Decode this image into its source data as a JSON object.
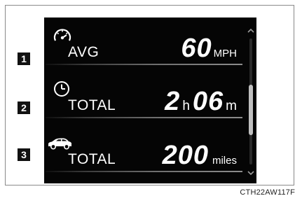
{
  "badges": [
    "1",
    "2",
    "3"
  ],
  "rows": [
    {
      "icon": "speedometer-icon",
      "label": "AVG",
      "value": "60",
      "unit": "MPH"
    },
    {
      "icon": "clock-icon",
      "label": "TOTAL",
      "hours": "2",
      "hours_unit": "h",
      "minutes": "06",
      "minutes_unit": "m"
    },
    {
      "icon": "car-icon",
      "label": "TOTAL",
      "value": "200",
      "unit": "miles"
    }
  ],
  "scroll": {
    "up_icon": "chevron-up-icon",
    "down_icon": "chevron-down-icon",
    "position_fraction": 0.5
  },
  "caption": "CTH22AW117F",
  "colors": {
    "screen_bg": "#050505",
    "text": "#ffffff",
    "badge_bg": "#111111"
  }
}
